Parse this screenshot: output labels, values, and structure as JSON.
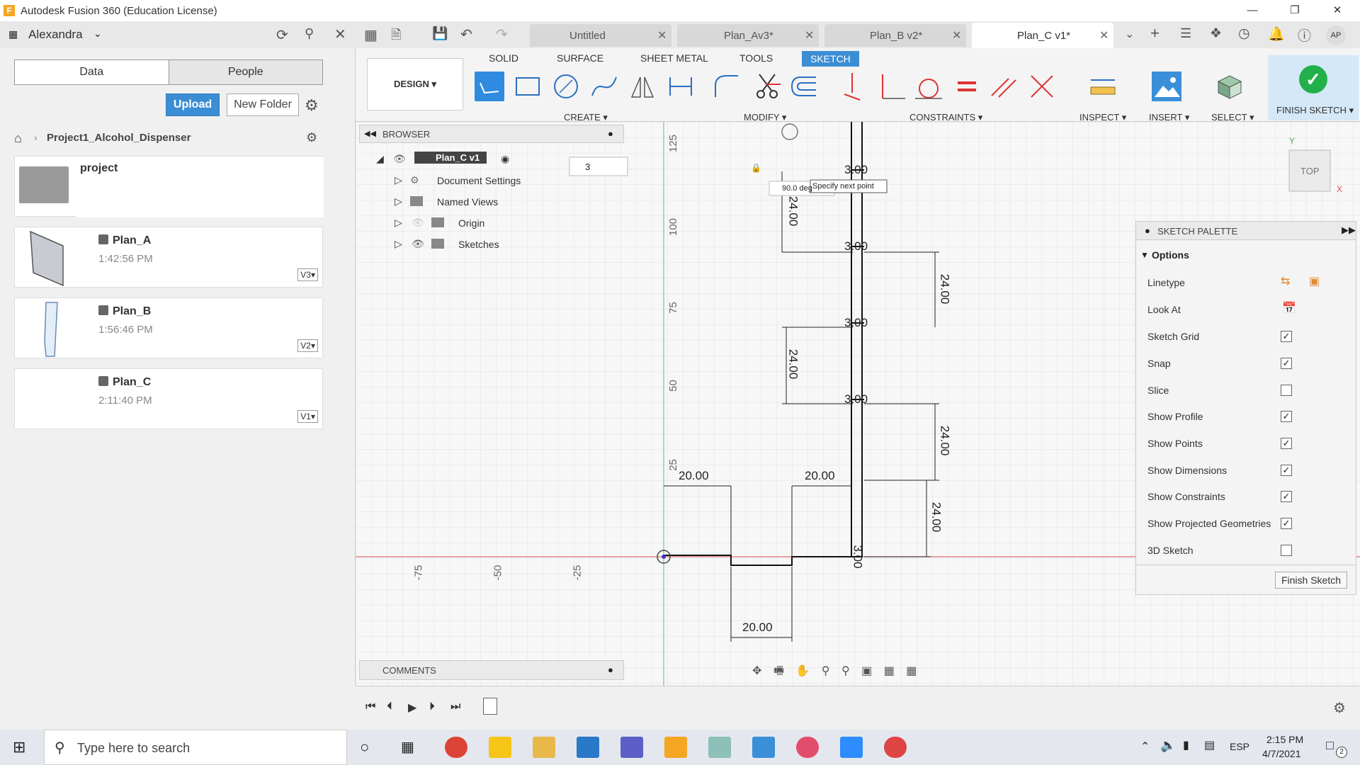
{
  "window": {
    "title": "Autodesk Fusion 360 (Education License)",
    "logo": "F"
  },
  "user": {
    "name": "Alexandra",
    "initials": "AP"
  },
  "doc_tabs": [
    {
      "label": "Untitled"
    },
    {
      "label": "Plan_Av3*"
    },
    {
      "label": "Plan_B v2*"
    },
    {
      "label": "Plan_C v1*"
    }
  ],
  "data_panel": {
    "tabs": [
      "Data",
      "People"
    ],
    "upload_label": "Upload",
    "new_folder_label": "New Folder",
    "breadcrumb": "Project1_Alcohol_Dispenser",
    "folder": "project",
    "items": [
      {
        "name": "Plan_A",
        "time": "1:42:56 PM",
        "version": "V3▾"
      },
      {
        "name": "Plan_B",
        "time": "1:56:46 PM",
        "version": "V2▾"
      },
      {
        "name": "Plan_C",
        "time": "2:11:40 PM",
        "version": "V1▾"
      }
    ]
  },
  "ribbon": {
    "workspace": "DESIGN ▾",
    "tabs": [
      "SOLID",
      "SURFACE",
      "SHEET METAL",
      "TOOLS",
      "SKETCH"
    ],
    "groups": [
      "CREATE ▾",
      "MODIFY ▾",
      "CONSTRAINTS ▾",
      "INSPECT ▾",
      "INSERT ▾",
      "SELECT ▾",
      "FINISH SKETCH ▾"
    ]
  },
  "browser": {
    "title": "BROWSER",
    "root": "Plan_C v1",
    "items": [
      "Document Settings",
      "Named Views",
      "Origin",
      "Sketches"
    ]
  },
  "comments": {
    "title": "COMMENTS"
  },
  "sketch": {
    "input_value": "3",
    "angle_readout": "90.0 deg",
    "tooltip": "Specify next point",
    "viewcube": "TOP",
    "axis_labels": [
      "125",
      "100",
      "75",
      "50",
      "25",
      "-75",
      "-50",
      "-25"
    ],
    "dims": [
      "3.00",
      "3.00",
      "3.00",
      "3.00",
      "24.00",
      "24.00",
      "24.00",
      "24.00",
      "24.00",
      "20.00",
      "20.00",
      "20.00",
      "3.00"
    ]
  },
  "palette": {
    "title": "SKETCH PALETTE",
    "section": "Options",
    "rows": [
      {
        "label": "Linetype"
      },
      {
        "label": "Look At"
      },
      {
        "label": "Sketch Grid",
        "checked": "✓"
      },
      {
        "label": "Snap",
        "checked": "✓"
      },
      {
        "label": "Slice",
        "checked": ""
      },
      {
        "label": "Show Profile",
        "checked": "✓"
      },
      {
        "label": "Show Points",
        "checked": "✓"
      },
      {
        "label": "Show Dimensions",
        "checked": "✓"
      },
      {
        "label": "Show Constraints",
        "checked": "✓"
      },
      {
        "label": "Show Projected Geometries",
        "checked": "✓"
      },
      {
        "label": "3D Sketch",
        "checked": ""
      }
    ],
    "finish_label": "Finish Sketch"
  },
  "taskbar": {
    "search_placeholder": "Type here to search",
    "lang": "ESP",
    "time": "2:15 PM",
    "date": "4/7/2021",
    "notif": "2"
  }
}
